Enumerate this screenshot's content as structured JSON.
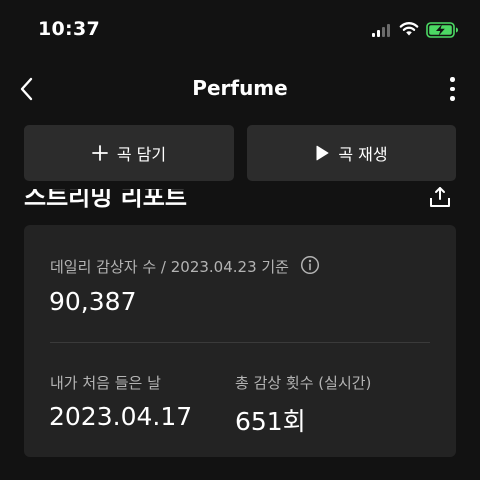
{
  "status_bar": {
    "time": "10:37",
    "colors": {
      "battery_fill": "#4cd964"
    }
  },
  "nav": {
    "title": "Perfume",
    "back_icon": "chevron-left-icon",
    "more_icon": "more-vertical-icon"
  },
  "actions": {
    "add_label": "곡 담기",
    "add_icon": "plus-icon",
    "play_label": "곡 재생",
    "play_icon": "play-icon"
  },
  "section": {
    "title": "스트리밍 리포트",
    "share_icon": "share-icon"
  },
  "stats": {
    "daily_label": "데일리 감상자 수 / 2023.04.23 기준",
    "daily_value": "90,387",
    "first_listen_label": "내가 처음 들은 날",
    "first_listen_value": "2023.04.17",
    "total_plays_label": "총 감상 횟수 (실시간)",
    "total_plays_value": "651회"
  },
  "colors": {
    "background": "#121212",
    "button_bg": "#2c2c2c",
    "card_bg": "#232323",
    "muted_text": "#b3b3b3"
  }
}
